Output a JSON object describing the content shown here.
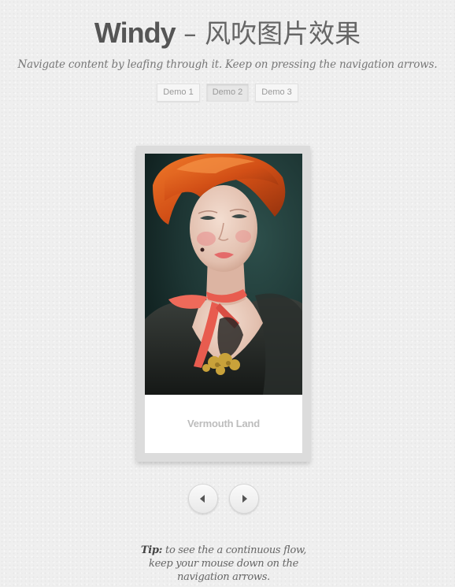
{
  "header": {
    "title_brand": "Windy",
    "title_rest": " – 风吹图片效果",
    "subtitle": "Navigate content by leafing through it. Keep on pressing the navigation arrows."
  },
  "demos": [
    {
      "label": "Demo 1"
    },
    {
      "label": "Demo 2",
      "active": true
    },
    {
      "label": "Demo 3"
    }
  ],
  "slide": {
    "caption": "Vermouth Land",
    "image": "portrait-woman-red-hair-red-ribbon"
  },
  "nav": {
    "prev_icon": "arrow-left-icon",
    "next_icon": "arrow-right-icon"
  },
  "tip": {
    "label": "Tip:",
    "text": " to see the a continuous flow, keep your mouse down on the navigation arrows."
  },
  "colors": {
    "background": "#efefef",
    "title": "#555555",
    "card_frame": "#dcdcdc",
    "caption": "#bdbdbd"
  }
}
